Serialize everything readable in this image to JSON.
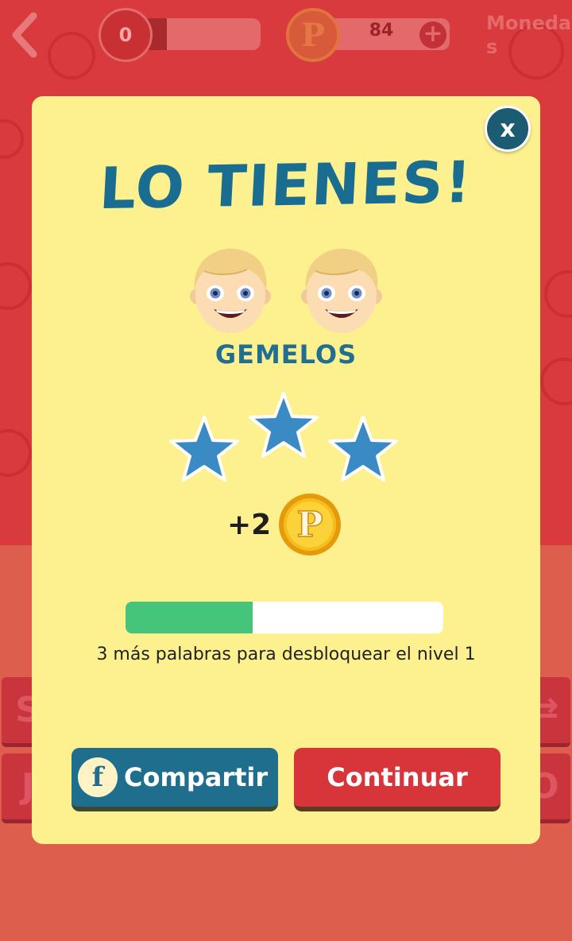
{
  "header": {
    "level_value": "0",
    "level_progress": 0.3,
    "coins_value": "84",
    "coins_plus_label": "+",
    "coins_icon_letter": "P",
    "monedas_label": "Monedas"
  },
  "background_tiles": {
    "left_row1": "S",
    "left_row2": "J",
    "right_row1": "⇄",
    "right_row2": "O"
  },
  "modal": {
    "close_label": "x",
    "title": "LO TIENES!",
    "answer": "GEMELOS",
    "emojis": [
      "boy-emoji",
      "boy-emoji"
    ],
    "stars_earned": 3,
    "reward_text": "+2",
    "reward_coin_letter": "P",
    "unlock_progress": 0.4,
    "unlock_text": "3 más palabras para desbloquear el nivel 1",
    "share_label": "Compartir",
    "facebook_letter": "f",
    "continue_label": "Continuar"
  },
  "colors": {
    "background_red": "#d83a3d",
    "modal_yellow": "#fdf08f",
    "title_blue": "#196d91",
    "star_blue": "#3a8bc4",
    "progress_green": "#44c579",
    "share_blue": "#1f6e8e",
    "continue_red": "#d8353a",
    "coin_gold": "#f2b416"
  }
}
